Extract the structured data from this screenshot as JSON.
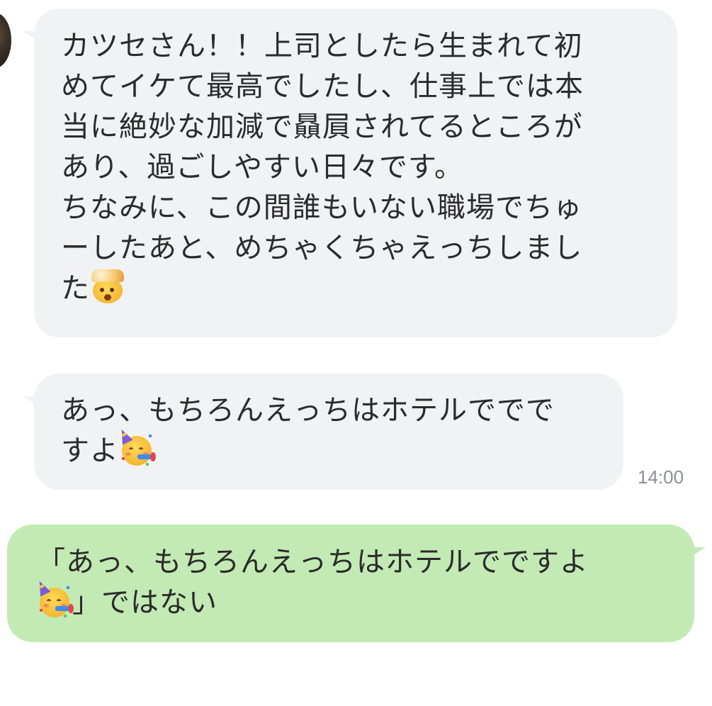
{
  "chat": {
    "messages": [
      {
        "direction": "incoming",
        "lines": [
          "カツセさん！！上司としたら生まれて初",
          "めてイケて最高でしたし、仕事上では本",
          "当に絶妙な加減で贔屓されてるところが",
          "あり、過ごしやすい日々です。",
          "ちなみに、この間誰もいない職場でちゅ",
          "ーしたあと、めちゃくちゃえっちしまし",
          "た"
        ],
        "trailing_emoji": "exploding-head-emoji"
      },
      {
        "direction": "incoming",
        "lines": [
          "あっ、もちろんえっちはホテルででで",
          "すよ"
        ],
        "trailing_emoji": "partying-face-emoji",
        "time": "14:00"
      },
      {
        "direction": "outgoing",
        "lines": [
          "「あっ、もちろんえっちはホテルでですよ",
          "」ではない"
        ],
        "leading_emoji_line2": "partying-face-emoji"
      }
    ]
  },
  "colors": {
    "background": "#ffffff",
    "incoming_bubble": "#f1f2f4",
    "outgoing_bubble": "#c3eab4",
    "text": "#2b2b2b",
    "timestamp": "#8a8f96"
  }
}
